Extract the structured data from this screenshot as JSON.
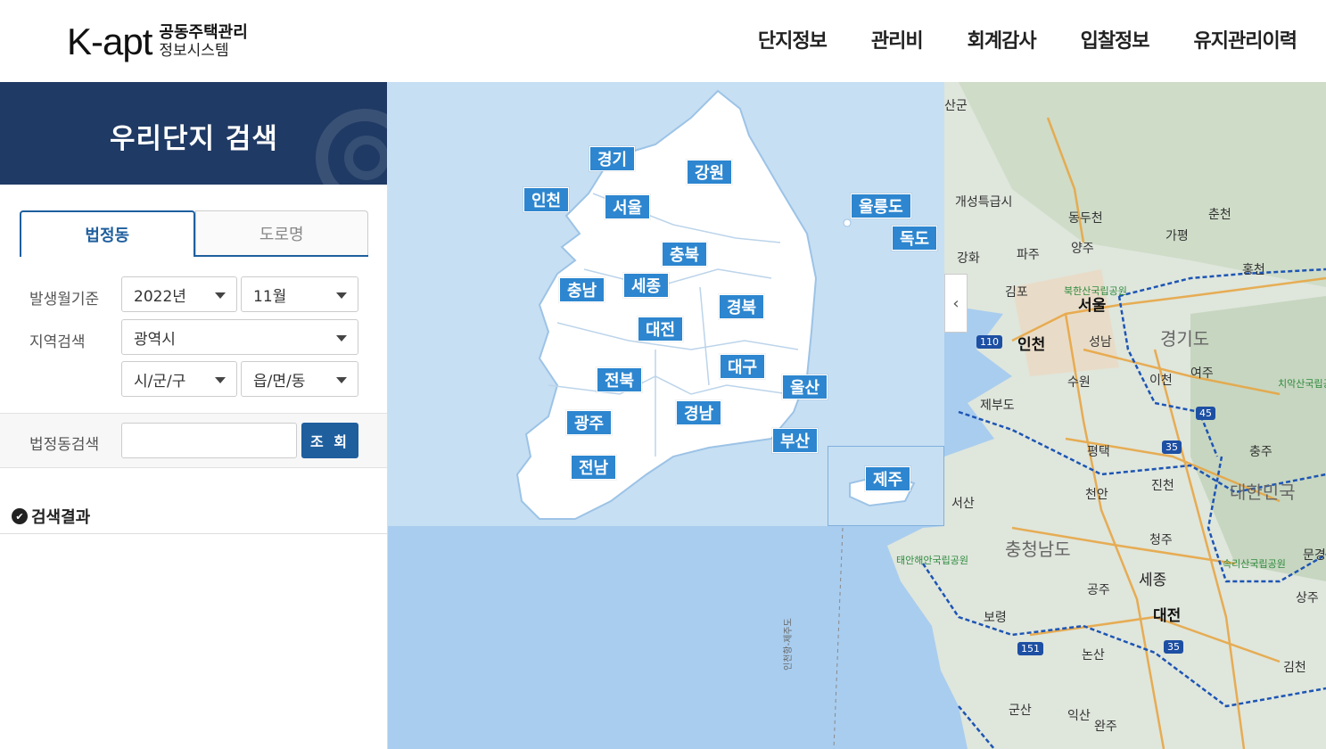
{
  "header": {
    "logo_main": "K-apt",
    "logo_line1": "공동주택관리",
    "logo_line2": "정보시스템",
    "nav": [
      "단지정보",
      "관리비",
      "회계감사",
      "입찰정보",
      "유지관리이력"
    ]
  },
  "sidebar": {
    "title": "우리단지 검색",
    "tabs": [
      {
        "label": "법정동",
        "active": true
      },
      {
        "label": "도로명",
        "active": false
      }
    ],
    "date_label": "발생월기준",
    "year_value": "2022년",
    "month_value": "11월",
    "region_label": "지역검색",
    "sido_value": "광역시",
    "sigungu_value": "시/군/구",
    "dong_value": "읍/면/동",
    "search_label": "법정동검색",
    "search_placeholder": "",
    "search_button": "조 회",
    "result_title": "검색결과"
  },
  "regions": [
    {
      "name": "경기"
    },
    {
      "name": "강원"
    },
    {
      "name": "인천"
    },
    {
      "name": "서울"
    },
    {
      "name": "울릉도"
    },
    {
      "name": "독도"
    },
    {
      "name": "충북"
    },
    {
      "name": "세종"
    },
    {
      "name": "충남"
    },
    {
      "name": "경북"
    },
    {
      "name": "대전"
    },
    {
      "name": "대구"
    },
    {
      "name": "울산"
    },
    {
      "name": "전북"
    },
    {
      "name": "경남"
    },
    {
      "name": "광주"
    },
    {
      "name": "부산"
    },
    {
      "name": "전남"
    },
    {
      "name": "제주"
    }
  ],
  "map_labels": [
    "산군",
    "개성특급시",
    "동두천",
    "춘천",
    "가평",
    "강화",
    "파주",
    "양주",
    "홍천",
    "김포",
    "북한산국립공원",
    "서울",
    "인천",
    "성남",
    "경기도",
    "여주",
    "제부도",
    "수원",
    "이천",
    "치악산국립공원",
    "평택",
    "충주",
    "천안",
    "진천",
    "대한민국",
    "서산",
    "충청남도",
    "청주",
    "태안해안국립공원",
    "세종",
    "공주",
    "속리산국립공원",
    "문경",
    "보령",
    "대전",
    "상주",
    "논산",
    "김천",
    "군산",
    "익산",
    "완주",
    "인천항-제주도"
  ],
  "highway_shields": [
    "110",
    "45",
    "35",
    "151",
    "35"
  ],
  "colors": {
    "brand_navy": "#1f3a64",
    "accent_blue": "#1f5f9e",
    "region_button": "#2d86cf",
    "sea": "#a9cdef"
  }
}
